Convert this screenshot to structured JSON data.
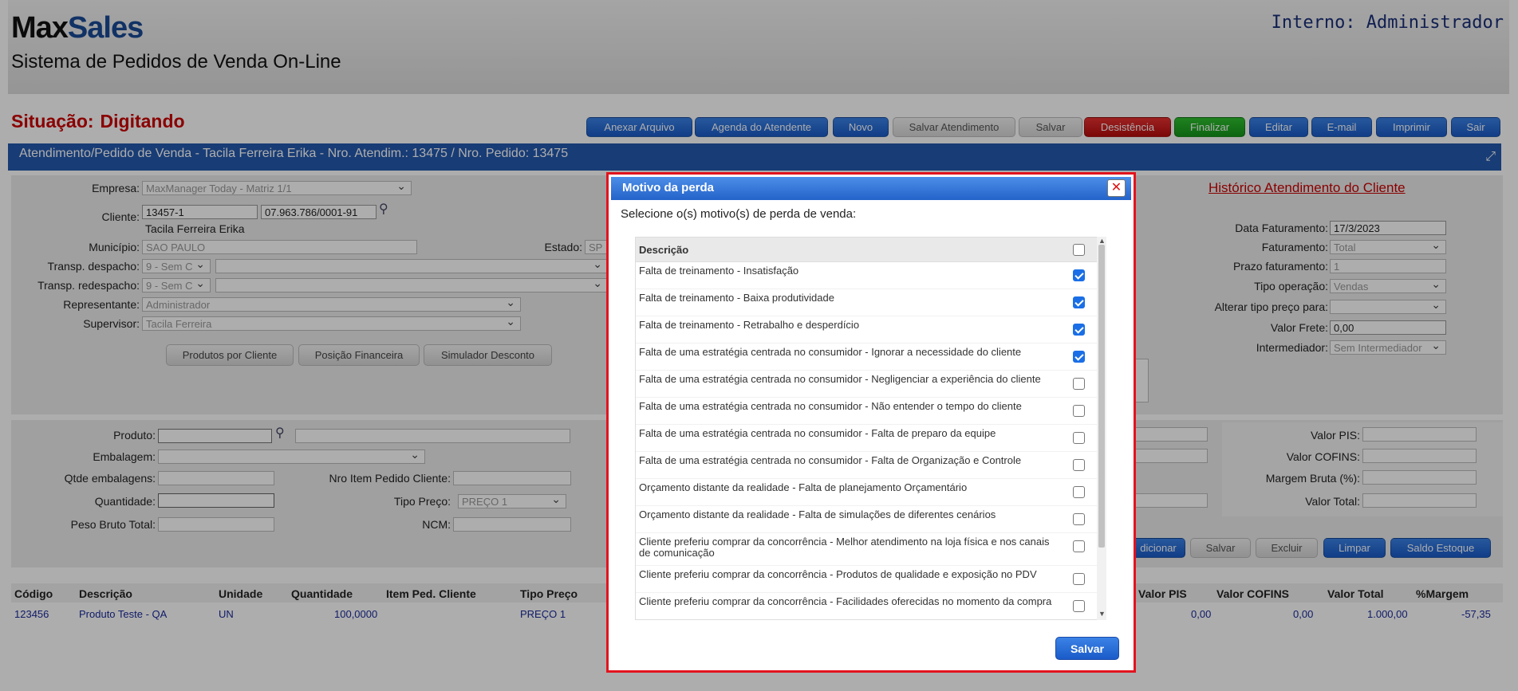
{
  "header": {
    "logo_max": "Max",
    "logo_sales": "Sales",
    "subtitle": "Sistema de Pedidos de Venda On-Line",
    "user": "Interno: Administrador"
  },
  "status": {
    "label": "Situação:",
    "value": "Digitando"
  },
  "toolbar": {
    "anexar": "Anexar Arquivo",
    "agenda": "Agenda do Atendente",
    "novo": "Novo",
    "salvar_atendimento": "Salvar Atendimento",
    "salvar": "Salvar",
    "desistencia": "Desistência",
    "finalizar": "Finalizar",
    "editar": "Editar",
    "email": "E-mail",
    "imprimir": "Imprimir",
    "sair": "Sair"
  },
  "title_bar": "Atendimento/Pedido de Venda - Tacila Ferreira Erika - Nro. Atendim.: 13475 / Nro. Pedido: 13475",
  "form": {
    "empresa_label": "Empresa:",
    "empresa_value": "MaxManager Today - Matriz 1/1",
    "cliente_label": "Cliente:",
    "cliente_code": "13457-1",
    "cliente_cnpj": "07.963.786/0001-91",
    "cliente_name": "Tacila Ferreira Erika",
    "municipio_label": "Município:",
    "municipio_value": "SAO PAULO",
    "estado_label": "Estado:",
    "estado_value": "SP",
    "transp_despacho_label": "Transp. despacho:",
    "transp_despacho_value": "9 - Sem C",
    "transp_redespacho_label": "Transp. redespacho:",
    "transp_redespacho_value": "9 - Sem C",
    "representante_label": "Representante:",
    "representante_value": "Administrador",
    "supervisor_label": "Supervisor:",
    "supervisor_value": "Tacila Ferreira",
    "btn_produtos_cliente": "Produtos por Cliente",
    "btn_posicao_financeira": "Posição Financeira",
    "btn_simulador": "Simulador Desconto"
  },
  "right_form": {
    "historico_link": "Histórico Atendimento do Cliente",
    "data_fat_label": "Data Faturamento:",
    "data_fat_value": "17/3/2023",
    "faturamento_label": "Faturamento:",
    "faturamento_value": "Total",
    "prazo_label": "Prazo faturamento:",
    "prazo_value": "1",
    "tipo_op_label": "Tipo operação:",
    "tipo_op_value": "Vendas",
    "alterar_label": "Alterar tipo preço para:",
    "alterar_value": "",
    "frete_label": "Valor Frete:",
    "frete_value": "0,00",
    "intermediador_label": "Intermediador:",
    "intermediador_value": "Sem Intermediador"
  },
  "product_form": {
    "produto_label": "Produto:",
    "embalagem_label": "Embalagem:",
    "qtde_emb_label": "Qtde embalagens:",
    "nro_item_label": "Nro Item Pedido Cliente:",
    "quantidade_label": "Quantidade:",
    "tipo_preco_label": "Tipo Preço:",
    "tipo_preco_value": "PREÇO 1",
    "peso_label": "Peso Bruto Total:",
    "ncm_label": "NCM:",
    "valor_pis_label": "Valor PIS:",
    "valor_cofins_label": "Valor COFINS:",
    "margem_label": "Margem Bruta (%):",
    "valor_total_label": "Valor Total:",
    "btn_adicionar": "dicionar",
    "btn_salvar": "Salvar",
    "btn_excluir": "Excluir",
    "btn_limpar": "Limpar",
    "btn_saldo": "Saldo Estoque"
  },
  "table": {
    "headers": [
      "Código",
      "Descrição",
      "Unidade",
      "Quantidade",
      "Item Ped. Cliente",
      "Tipo Preço",
      "Valor PIS",
      "Valor COFINS",
      "Valor Total",
      "%Margem"
    ],
    "row": [
      "123456",
      "Produto Teste - QA",
      "UN",
      "100,0000",
      "",
      "PREÇO 1",
      "0,00",
      "0,00",
      "1.000,00",
      "-57,35"
    ]
  },
  "modal": {
    "title": "Motivo da perda",
    "prompt": "Selecione o(s) motivo(s) de perda de venda:",
    "column": "Descrição",
    "save": "Salvar",
    "items": [
      {
        "label": "Falta de treinamento - Insatisfação",
        "checked": true
      },
      {
        "label": "Falta de treinamento - Baixa produtividade",
        "checked": true
      },
      {
        "label": "Falta de treinamento - Retrabalho e desperdício",
        "checked": true
      },
      {
        "label": "Falta de uma estratégia centrada no consumidor - Ignorar a necessidade do cliente",
        "checked": true
      },
      {
        "label": "Falta de uma estratégia centrada no consumidor - Negligenciar a experiência do cliente",
        "checked": false
      },
      {
        "label": "Falta de uma estratégia centrada no consumidor - Não entender o tempo do cliente",
        "checked": false
      },
      {
        "label": "Falta de uma estratégia centrada no consumidor - Falta de preparo da equipe",
        "checked": false
      },
      {
        "label": "Falta de uma estratégia centrada no consumidor - Falta de Organização e Controle",
        "checked": false
      },
      {
        "label": "Orçamento distante da realidade - Falta de planejamento Orçamentário",
        "checked": false
      },
      {
        "label": "Orçamento distante da realidade - Falta de simulações de diferentes cenários",
        "checked": false
      },
      {
        "label": "Cliente preferiu comprar da concorrência - Melhor atendimento na loja física e nos canais de comunicação",
        "checked": false
      },
      {
        "label": "Cliente preferiu comprar da concorrência - Produtos de qualidade e exposição no PDV",
        "checked": false
      },
      {
        "label": "Cliente preferiu comprar da concorrência - Facilidades oferecidas no momento da compra",
        "checked": false
      }
    ]
  }
}
